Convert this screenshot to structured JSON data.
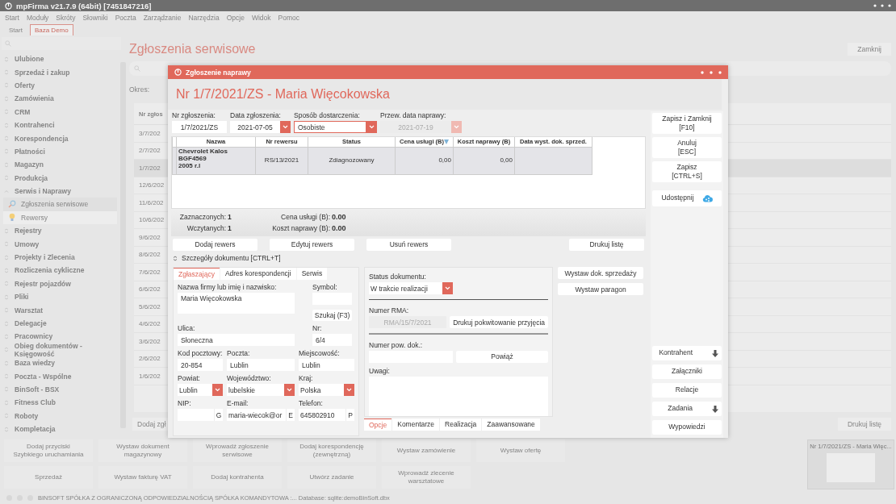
{
  "app": {
    "title": "mpFirma v21.7.9 (64bit) [7451847216]",
    "menu": [
      "Start",
      "Moduły",
      "Skróty",
      "Słowniki",
      "Poczta",
      "Zarządzanie",
      "Narzędzia",
      "Opcje",
      "Widok",
      "Pomoc"
    ],
    "tabs": [
      {
        "label": "Start",
        "selected": false
      },
      {
        "label": "Baza Demo",
        "selected": true
      }
    ],
    "sidebar": {
      "items": [
        {
          "label": "Ulubione",
          "expanded": false
        },
        {
          "label": "Sprzedaż i zakup",
          "expanded": false
        },
        {
          "label": "Oferty",
          "expanded": false
        },
        {
          "label": "Zamówienia",
          "expanded": false
        },
        {
          "label": "CRM",
          "expanded": false
        },
        {
          "label": "Kontrahenci",
          "expanded": false
        },
        {
          "label": "Korespondencja",
          "expanded": false
        },
        {
          "label": "Płatności",
          "expanded": false
        },
        {
          "label": "Magazyn",
          "expanded": false
        },
        {
          "label": "Produkcja",
          "expanded": false
        },
        {
          "label": "Serwis i Naprawy",
          "expanded": true,
          "children": [
            {
              "label": "Zgłoszenia serwisowe",
              "selected": true
            },
            {
              "label": "Rewersy",
              "selected": false
            }
          ]
        },
        {
          "label": "Rejestry",
          "expanded": false
        },
        {
          "label": "Umowy",
          "expanded": false
        },
        {
          "label": "Projekty i Zlecenia",
          "expanded": false
        },
        {
          "label": "Rozliczenia cykliczne",
          "expanded": false
        },
        {
          "label": "Rejestr pojazdów",
          "expanded": false
        },
        {
          "label": "Pliki",
          "expanded": false
        },
        {
          "label": "Warsztat",
          "expanded": false
        },
        {
          "label": "Delegacje",
          "expanded": false
        },
        {
          "label": "Pracownicy",
          "expanded": false
        },
        {
          "label": "Obieg dokumentów - Księgowość",
          "expanded": false
        },
        {
          "label": "Baza wiedzy",
          "expanded": false
        },
        {
          "label": "Poczta - Wspólne",
          "expanded": false
        },
        {
          "label": "BinSoft - BSX",
          "expanded": false
        },
        {
          "label": "Fitness Club",
          "expanded": false
        },
        {
          "label": "Roboty",
          "expanded": false
        },
        {
          "label": "Kompletacja",
          "expanded": false
        }
      ]
    },
    "page": {
      "title": "Zgłoszenia serwisowe",
      "close_button": "Zamknij",
      "period_label": "Okres:",
      "table": {
        "columns": [
          "Nr zgłos"
        ],
        "rows": [
          {
            "cell": "3/7/202",
            "selected": false
          },
          {
            "cell": "2/7/202",
            "selected": false
          },
          {
            "cell": "1/7/202",
            "selected": true
          },
          {
            "cell": "12/6/202",
            "selected": false
          },
          {
            "cell": "11/6/202",
            "selected": false
          },
          {
            "cell": "10/6/202",
            "selected": false
          },
          {
            "cell": "9/6/202",
            "selected": false
          },
          {
            "cell": "8/6/202",
            "selected": false
          },
          {
            "cell": "7/6/202",
            "selected": false
          },
          {
            "cell": "6/6/202",
            "selected": false
          },
          {
            "cell": "5/6/202",
            "selected": false
          },
          {
            "cell": "4/6/202",
            "selected": false
          },
          {
            "cell": "3/6/202",
            "selected": false
          },
          {
            "cell": "2/6/202",
            "selected": false
          },
          {
            "cell": "1/6/202",
            "selected": false
          }
        ]
      },
      "add_button": "Dodaj zgł",
      "print_button": "Drukuj listę"
    },
    "quick_actions": [
      [
        "Dodaj przyciski\nSzybkiego uruchamiania",
        "Wystaw dokument\nmagazynowy",
        "Wprowadź zgłoszenie\nserwisowe",
        "Dodaj korespondencję\n(zewnętrzną)",
        "Wystaw zamówienie",
        "Wystaw ofertę"
      ],
      [
        "Sprzedaż",
        "Wystaw fakturę VAT",
        "Dodaj kontrahenta",
        "Utwórz zadanie",
        "Wprowadź zlecenie\nwarsztatowe"
      ]
    ],
    "thumbnail": {
      "title": "Nr 1/7/2021/ZS - Maria Więc..."
    },
    "status_bar": "BINSOFT SPÓŁKA Z OGRANICZONĄ ODPOWIEDZIALNOŚCIĄ SPÓŁKA KOMANDYTOWA :... Database: sqlite:demoBinSoft.dbx"
  },
  "dialog": {
    "title": "Zgłoszenie naprawy",
    "heading": "Nr 1/7/2021/ZS - Maria Więcokowska",
    "header_fields": [
      {
        "label": "Nr zgłoszenia:",
        "value": "1/7/2021/ZS",
        "kind": "text",
        "disabled": false
      },
      {
        "label": "Data zgłoszenia:",
        "value": "2021-07-05",
        "kind": "date",
        "disabled": false
      },
      {
        "label": "Sposób dostarczenia:",
        "value": "Osobiste",
        "kind": "select",
        "disabled": false
      },
      {
        "label": "Przew. data naprawy:",
        "value": "2021-07-19",
        "kind": "date",
        "disabled": true
      }
    ],
    "table": {
      "columns": [
        "Nazwa",
        "Nr rewersu",
        "Status",
        "Cena usługi (B)",
        "Koszt naprawy (B)",
        "Data wyst. dok. sprzed."
      ],
      "rows": [
        {
          "selected": true,
          "cells": [
            "Chevrolet Kalos\nBGF4569\n2005 r.l",
            "RS/13/2021",
            "Zdiagnozowany",
            "0,00",
            "0,00"
          ]
        }
      ]
    },
    "counts": [
      {
        "label": "Zaznaczonych:",
        "value": "1"
      },
      {
        "label": "Wczytanych:",
        "value": "1"
      }
    ],
    "totals": [
      {
        "label": "Cena usługi (B):",
        "value": "0.00"
      },
      {
        "label": "Koszt naprawy (B):",
        "value": "0.00"
      }
    ],
    "table_buttons": [
      "Dodaj rewers",
      "Edytuj rewers",
      "Usuń rewers"
    ],
    "print_button": "Drukuj listę",
    "details": {
      "title": "Szczegóły dokumentu [CTRL+T]",
      "expanded": true
    },
    "party_tabs": [
      {
        "label": "Zgłaszający",
        "selected": true
      },
      {
        "label": "Adres korespondencji",
        "selected": false
      },
      {
        "label": "Serwis",
        "selected": false
      }
    ],
    "party_rows": [
      [
        {
          "label": "Nazwa firmy lub imię i nazwisko:",
          "value": "Maria Więcokowska",
          "kind": "textarea"
        },
        {
          "label": "Symbol:",
          "kind": "text",
          "button": "Szukaj (F3)"
        }
      ],
      [
        {
          "label": "Ulica:",
          "value": "Słoneczna",
          "kind": "text"
        },
        {
          "label": "Nr:",
          "value": "6/4",
          "kind": "text"
        }
      ],
      [
        {
          "label": "Kod pocztowy:",
          "value": "20-854",
          "kind": "text"
        },
        {
          "label": "Poczta:",
          "value": "Lublin",
          "kind": "text"
        },
        {
          "label": "Miejscowość:",
          "value": "Lublin",
          "kind": "text"
        }
      ],
      [
        {
          "label": "Powiat:",
          "value": "Lublin",
          "kind": "select"
        },
        {
          "label": "Województwo:",
          "value": "lubelskie",
          "kind": "select"
        },
        {
          "label": "Kraj:",
          "value": "Polska",
          "kind": "select"
        }
      ],
      [
        {
          "label": "NIP:",
          "kind": "suffixed",
          "suffix": "G"
        },
        {
          "label": "E-mail:",
          "value": "maria-wiecok@or",
          "kind": "suffixed",
          "suffix": "E"
        },
        {
          "label": "Telefon:",
          "value": "645802910",
          "kind": "suffixed",
          "suffix": "P"
        }
      ]
    ],
    "document_status": {
      "label": "Status dokumentu:",
      "value": "W trakcie realizacji"
    },
    "rma": {
      "label": "Numer RMA:",
      "value": "RMA/15/7/2021",
      "disabled": true,
      "button": "Drukuj pokwitowanie przyjęcia"
    },
    "related_doc": {
      "label": "Numer pow. dok.:",
      "button": "Powiąż"
    },
    "notes": {
      "label": "Uwagi:"
    },
    "option_tabs": [
      {
        "label": "Opcje",
        "selected": true
      },
      {
        "label": "Komentarze",
        "selected": false
      },
      {
        "label": "Realizacja",
        "selected": false
      },
      {
        "label": "Zaawansowane",
        "selected": false
      }
    ],
    "sales_buttons": [
      "Wystaw dok. sprzedaży",
      "Wystaw paragon"
    ],
    "side_buttons": [
      {
        "label": "Zapisz i Zamknij\n[F10]",
        "kind": "plain"
      },
      {
        "label": "Anuluj\n[ESC]",
        "kind": "plain"
      },
      {
        "label": "Zapisz\n[CTRL+S]",
        "kind": "plain"
      },
      {
        "label": "Udostępnij",
        "kind": "share"
      }
    ],
    "side_buttons_bottom": [
      {
        "label": "Kontrahent",
        "kind": "expand"
      },
      {
        "label": "Załączniki",
        "kind": "plain"
      },
      {
        "label": "Relacje",
        "kind": "plain"
      },
      {
        "label": "Zadania",
        "kind": "expand"
      },
      {
        "label": "Wypowiedzi",
        "kind": "plain"
      }
    ]
  }
}
